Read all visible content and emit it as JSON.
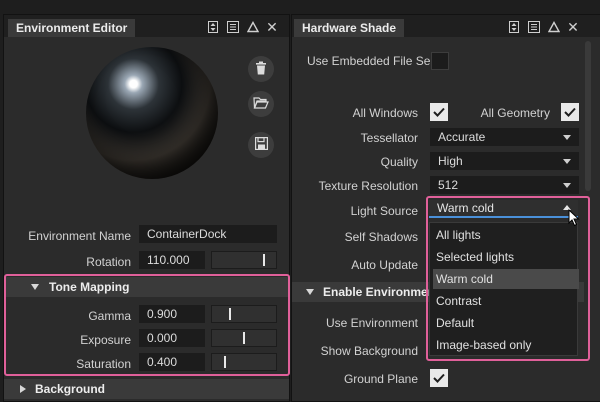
{
  "left_panel": {
    "title": "Environment Editor",
    "env_name_label": "Environment Name",
    "env_name_value": "ContainerDock",
    "rotation_label": "Rotation",
    "rotation_value": "110.000",
    "rotation_slider_fraction": 0.84,
    "tone_mapping": {
      "header": "Tone Mapping",
      "rows": [
        {
          "label": "Gamma",
          "value": "0.900",
          "slider_fraction": 0.25
        },
        {
          "label": "Exposure",
          "value": "0.000",
          "slider_fraction": 0.5
        },
        {
          "label": "Saturation",
          "value": "0.400",
          "slider_fraction": 0.18
        }
      ]
    },
    "background_header": "Background",
    "side_icons": [
      "trash-icon",
      "folder-open-icon",
      "save-icon"
    ]
  },
  "right_panel": {
    "title": "Hardware Shade",
    "use_embedded_label": "Use Embedded File Se...",
    "use_embedded_checked": false,
    "all_windows_label": "All Windows",
    "all_windows_checked": true,
    "all_geometry_label": "All Geometry",
    "all_geometry_checked": true,
    "tessellator_label": "Tessellator",
    "tessellator_value": "Accurate",
    "quality_label": "Quality",
    "quality_value": "High",
    "texture_resolution_label": "Texture Resolution",
    "texture_resolution_value": "512",
    "light_source_label": "Light Source",
    "light_source_value": "Warm cold",
    "self_shadows_label": "Self Shadows",
    "auto_update_label": "Auto Update",
    "enable_env_header": "Enable Environment",
    "use_environment_label": "Use Environment",
    "show_background_label": "Show Background",
    "ground_plane_label": "Ground Plane",
    "ground_plane_checked": true,
    "dropdown_options": [
      "All lights",
      "Selected lights",
      "Warm cold",
      "Contrast",
      "Default",
      "Image-based only"
    ],
    "dropdown_selected_index": 2
  },
  "colors": {
    "highlight": "#e0609a",
    "panel_bg": "#2b2b2b",
    "field_bg": "#1c1c1c",
    "focus_underline": "#4a90d9"
  }
}
